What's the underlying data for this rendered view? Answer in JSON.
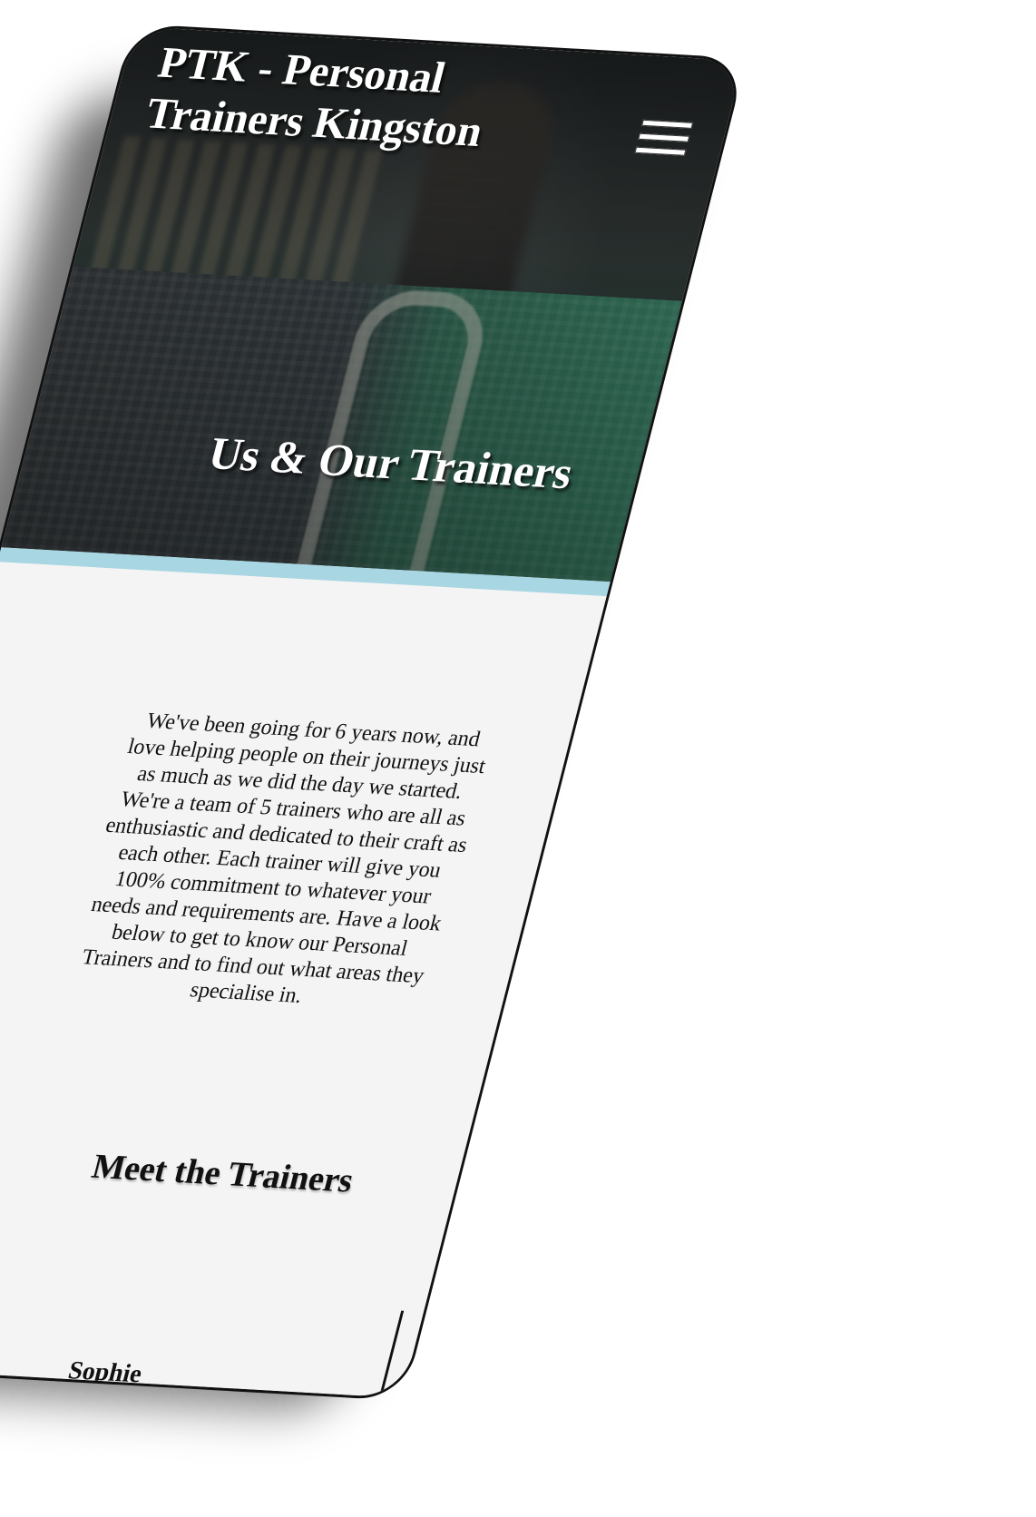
{
  "header": {
    "brand": "PTK - Personal Trainers Kingston",
    "menu_icon": "hamburger-menu-icon"
  },
  "hero": {
    "title": "Us & Our Trainers"
  },
  "about": {
    "text": "We've been going for 6 years now, and love helping people on their journeys just as much as we did the day we started. We're a team of 5 trainers who are all as enthusiastic and dedicated to their craft as each other. Each trainer will give you 100% commitment to whatever your needs and requirements are. Have a look below to get to know our Personal Trainers and to find out what areas they specialise in."
  },
  "trainers": {
    "heading": "Meet the Trainers",
    "items": [
      {
        "name": "Sophie"
      }
    ]
  },
  "colors": {
    "accent": "#a9d6e3",
    "page_background": "#f4f4f4",
    "text": "#111111"
  }
}
